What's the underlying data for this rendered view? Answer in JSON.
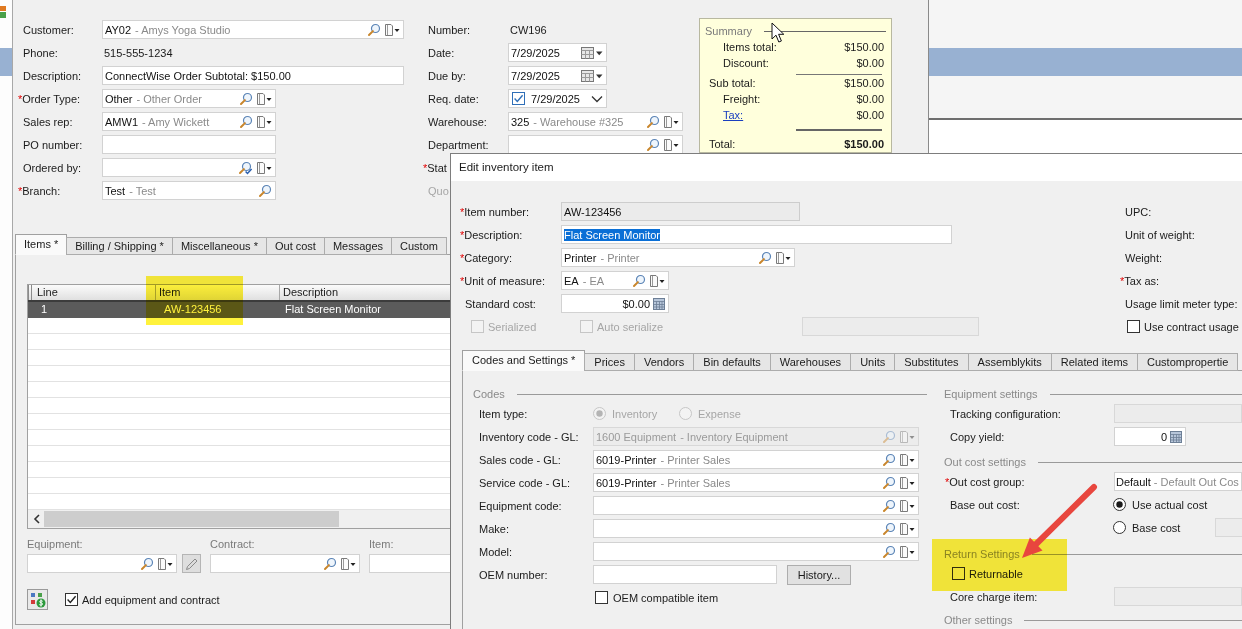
{
  "order_form": {
    "fields_left": [
      {
        "label": "Customer:",
        "kind": "lookup",
        "value": "AY02",
        "detail": "- Amys Yoga Studio"
      },
      {
        "label": "Phone:",
        "kind": "static",
        "value": "515-555-1234"
      },
      {
        "label": "Description:",
        "kind": "text",
        "value": "ConnectWise Order Subtotal: $150.00"
      },
      {
        "label": "Order Type:",
        "mark": "*",
        "kind": "lookup",
        "value": "Other",
        "detail": "- Other Order"
      },
      {
        "label": "Sales rep:",
        "kind": "lookup",
        "value": "AMW1",
        "detail": "- Amy Wickett"
      },
      {
        "label": "PO number:",
        "kind": "text"
      },
      {
        "label": "Ordered by:",
        "kind": "userlookup"
      },
      {
        "label": "Branch:",
        "mark": "*",
        "kind": "search",
        "value": "Test",
        "detail": "- Test"
      }
    ],
    "fields_right": [
      {
        "label": "Number:",
        "kind": "static",
        "value": "CW196",
        "disabled": false
      },
      {
        "label": "Date:",
        "kind": "date",
        "value": "7/29/2025",
        "disabled": false
      },
      {
        "label": "Due by:",
        "kind": "date",
        "value": "7/29/2025",
        "disabled": false
      },
      {
        "label": "Req. date:",
        "kind": "checkdate",
        "value": "7/29/2025",
        "checked": true,
        "disabled": false
      },
      {
        "label": "Warehouse:",
        "kind": "lookup",
        "value": "325",
        "detail": "- Warehouse #325",
        "disabled": false
      },
      {
        "label": "Department:",
        "kind": "lookup",
        "disabled": false
      },
      {
        "label": "Stat",
        "mark": "*",
        "kind": "label",
        "disabled": false
      },
      {
        "label": "Quo",
        "kind": "label",
        "disabled": true
      }
    ],
    "summary": {
      "title": "Summary",
      "rows": [
        {
          "kind": "detail",
          "label": "Items total:",
          "value": "$150.00"
        },
        {
          "kind": "detail",
          "label": "Discount:",
          "value": "$0.00"
        },
        {
          "kind": "subtotal",
          "label": "Sub total:",
          "value": "$150.00"
        },
        {
          "kind": "detail",
          "label": "Freight:",
          "value": "$0.00"
        },
        {
          "kind": "link",
          "label": "Tax:",
          "value": "$0.00"
        },
        {
          "kind": "total",
          "label": "Total:",
          "value": "$150.00"
        }
      ]
    },
    "tabs": [
      {
        "label": "Items *",
        "selected": true
      },
      {
        "label": "Billing / Shipping *",
        "selected": false
      },
      {
        "label": "Miscellaneous *",
        "selected": false
      },
      {
        "label": "Out cost",
        "selected": false
      },
      {
        "label": "Messages",
        "selected": false
      },
      {
        "label": "Custom",
        "selected": false
      }
    ],
    "grid": {
      "columns": [
        {
          "label": "Line",
          "highlighted": false
        },
        {
          "label": "Item",
          "highlighted": true
        },
        {
          "label": "Description",
          "highlighted": false
        }
      ],
      "rows": [
        {
          "cells": [
            "1",
            "AW-123456",
            "Flat Screen Monitor"
          ],
          "selected": true
        }
      ]
    },
    "links": [
      {
        "label": "Equipment:",
        "kind": "lookup",
        "edit_button": true
      },
      {
        "label": "Contract:",
        "kind": "lookup"
      },
      {
        "label": "Item:",
        "kind": "text"
      }
    ],
    "add_option": {
      "label": "Add equipment and contract",
      "checked": true
    }
  },
  "dialog": {
    "title": "Edit inventory item",
    "fields": [
      {
        "label": "Item number:",
        "mark": "*",
        "kind": "readonly",
        "value": "AW-123456"
      },
      {
        "label": "Description:",
        "mark": "*",
        "kind": "text",
        "value": "Flat Screen Monitor",
        "text_selected": true
      },
      {
        "label": "Category:",
        "mark": "*",
        "kind": "lookup",
        "value": "Printer",
        "detail": "- Printer"
      },
      {
        "label": "Unit of measure:",
        "mark": "*",
        "kind": "lookup",
        "value": "EA",
        "detail": "- EA"
      },
      {
        "label": "Standard cost:",
        "kind": "number",
        "value": "$0.00"
      }
    ],
    "option_row": [
      {
        "kind": "checkbox",
        "label": "Serialized",
        "checked": false,
        "disabled": true
      },
      {
        "kind": "checkbox",
        "label": "Auto serialize",
        "checked": false,
        "disabled": true
      },
      {
        "kind": "text",
        "disabled": true
      }
    ],
    "side_fields": [
      {
        "label": "UPC:"
      },
      {
        "label": "Unit of weight:"
      },
      {
        "label": "Weight:"
      },
      {
        "label": "Tax as:",
        "mark": "*"
      },
      {
        "label": "Usage limit meter type:"
      }
    ],
    "side_check": {
      "label": "Use contract usage",
      "checked": false
    },
    "tabs": [
      {
        "label": "Codes and Settings *",
        "selected": true
      },
      {
        "label": "Prices",
        "selected": false
      },
      {
        "label": "Vendors",
        "selected": false
      },
      {
        "label": "Bin defaults",
        "selected": false
      },
      {
        "label": "Warehouses",
        "selected": false
      },
      {
        "label": "Units",
        "selected": false
      },
      {
        "label": "Substitutes",
        "selected": false
      },
      {
        "label": "Assemblykits",
        "selected": false
      },
      {
        "label": "Related items",
        "selected": false
      },
      {
        "label": "Custompropertie",
        "selected": false
      }
    ],
    "codes": {
      "title": "Codes",
      "rows": [
        {
          "label": "Item type:",
          "kind": "radios",
          "disabled": true,
          "options": [
            {
              "label": "Inventory",
              "selected": true
            },
            {
              "label": "Expense",
              "selected": false
            }
          ]
        },
        {
          "label": "Inventory code - GL:",
          "kind": "lookup",
          "value": "1600 Equipment",
          "detail": "- Inventory Equipment",
          "disabled": true
        },
        {
          "label": "Sales code - GL:",
          "kind": "lookup",
          "value": "6019-Printer",
          "detail": "- Printer Sales",
          "disabled": false
        },
        {
          "label": "Service code - GL:",
          "kind": "lookup",
          "value": "6019-Printer",
          "detail": "- Printer Sales",
          "disabled": false
        },
        {
          "label": "Equipment code:",
          "kind": "lookup",
          "disabled": false
        },
        {
          "label": "Make:",
          "kind": "lookup",
          "disabled": false
        },
        {
          "label": "Model:",
          "kind": "lookup",
          "disabled": false
        },
        {
          "label": "OEM number:",
          "kind": "textbutton",
          "button": "History...",
          "disabled": false
        },
        {
          "label": "OEM compatible item",
          "kind": "checkbox",
          "checked": false,
          "disabled": false
        }
      ]
    },
    "sections": [
      {
        "title": "Equipment settings",
        "rows": [
          {
            "label": "Tracking configuration:",
            "kind": "text",
            "disabled": true
          },
          {
            "label": "Copy yield:",
            "kind": "number",
            "value": "0",
            "disabled": false
          }
        ]
      },
      {
        "title": "Out cost settings",
        "rows": [
          {
            "label": "Out cost group:",
            "mark": "*",
            "kind": "text",
            "value": "Default",
            "detail": "- Default Out Cos",
            "disabled": false
          },
          {
            "label": "Base out cost:",
            "kind": "radiostack",
            "disabled": false,
            "options": [
              {
                "label": "Use actual cost",
                "selected": true
              },
              {
                "label": "Base cost",
                "selected": false,
                "field": {
                  "kind": "text",
                  "disabled": true
                }
              }
            ]
          }
        ]
      },
      {
        "title": "Return Settings",
        "highlighted": true,
        "arrow": true,
        "rows": [
          {
            "label": "Returnable",
            "kind": "checkbox",
            "checked": false,
            "disabled": false
          },
          {
            "label": "Core charge item:",
            "kind": "text",
            "disabled": true
          }
        ]
      },
      {
        "title": "Other settings"
      }
    ]
  }
}
